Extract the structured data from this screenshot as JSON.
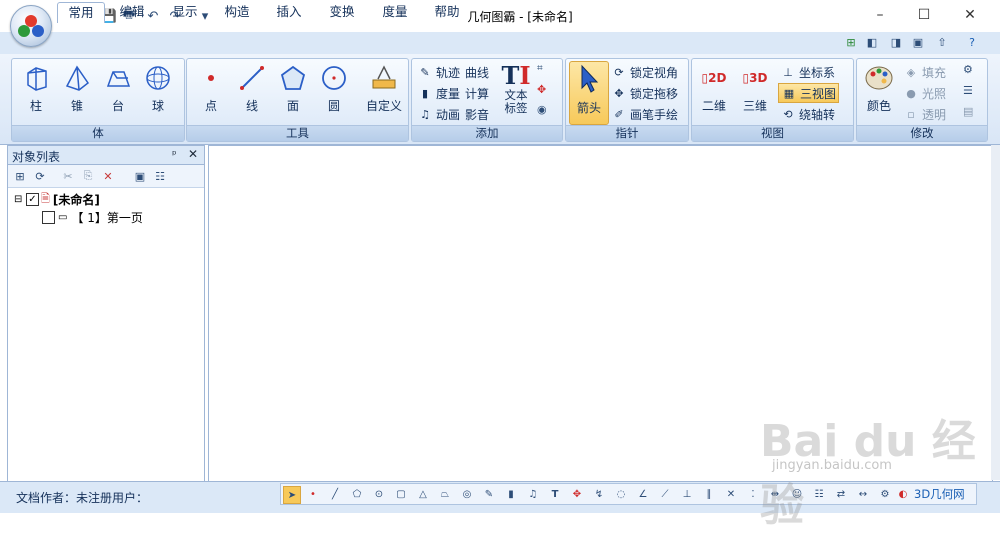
{
  "window": {
    "title": "几何图霸 - [未命名]",
    "minimize": "–",
    "maximize": "☐",
    "close": "✕"
  },
  "quick_access": {
    "dropdown": "▾"
  },
  "tabs": [
    {
      "label": "常用",
      "active": true
    },
    {
      "label": "编辑"
    },
    {
      "label": "显示"
    },
    {
      "label": "构造"
    },
    {
      "label": "插入"
    },
    {
      "label": "变换"
    },
    {
      "label": "度量"
    },
    {
      "label": "帮助"
    }
  ],
  "ribbon": {
    "groups": {
      "ti": {
        "label": "体",
        "buttons": [
          "柱",
          "锥",
          "台",
          "球"
        ]
      },
      "tools": {
        "label": "工具",
        "buttons": [
          "点",
          "线",
          "面",
          "圆",
          "自定义"
        ]
      },
      "add": {
        "label": "添加",
        "small": [
          "轨迹",
          "曲线",
          "度量",
          "计算",
          "动画",
          "影音"
        ],
        "text_label": "文本标签"
      },
      "pointer": {
        "label": "指针",
        "big": "箭头",
        "small": [
          "锁定视角",
          "锁定拖移",
          "画笔手绘"
        ]
      },
      "view": {
        "label": "视图",
        "big": [
          "二维",
          "三维"
        ],
        "small": [
          "坐标系",
          "三视图",
          "绕轴转"
        ]
      },
      "modify": {
        "label": "修改",
        "big": "颜色",
        "small": [
          "填充",
          "光照",
          "透明"
        ]
      }
    }
  },
  "panel": {
    "title": "对象列表",
    "pin": "ᵖ",
    "close": "✕",
    "tree": {
      "root": "[未命名]",
      "page": "【 1】第一页"
    }
  },
  "status": {
    "author": "文档作者：未注册用户：",
    "site_link": "3D几何网"
  },
  "colors": {
    "accent": "#1a5fb4",
    "ribbon_bg": "#dbe8f7",
    "selected_tool": "#f7c95a"
  }
}
